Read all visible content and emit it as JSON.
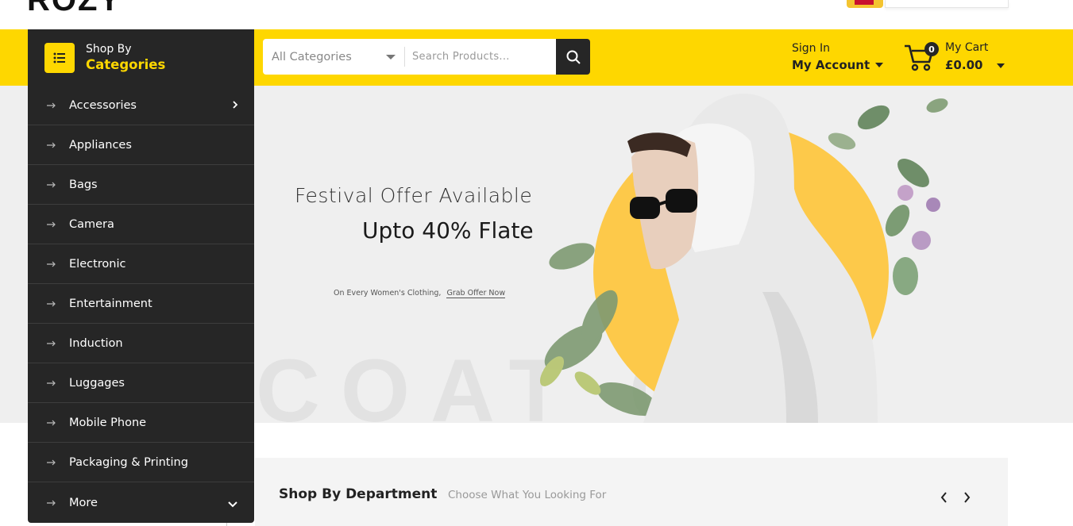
{
  "logo": {
    "text": "ROZY"
  },
  "categories": {
    "heading_line1": "Shop By",
    "heading_line2": "Categories",
    "items": [
      {
        "label": "Accessories",
        "has_submenu": true
      },
      {
        "label": "Appliances"
      },
      {
        "label": "Bags"
      },
      {
        "label": "Camera"
      },
      {
        "label": "Electronic"
      },
      {
        "label": "Entertainment"
      },
      {
        "label": "Induction"
      },
      {
        "label": "Luggages"
      },
      {
        "label": "Mobile Phone"
      },
      {
        "label": "Packaging & Printing"
      }
    ],
    "more_label": "More"
  },
  "search": {
    "category_selected": "All Categories",
    "placeholder": "Search Products..."
  },
  "account": {
    "sign_in": "Sign In",
    "my_account": "My Account"
  },
  "cart": {
    "count": "0",
    "label": "My Cart",
    "amount": "£0.00"
  },
  "hero": {
    "headline1": "Festival Offer Available",
    "headline2": "Upto 40% Flate",
    "subtext": "On Every Women's Clothing,",
    "cta": "Grab Offer Now",
    "watermark": "COAT   OY"
  },
  "department": {
    "title": "Shop By Department",
    "subtitle": "Choose What You Looking For"
  },
  "colors": {
    "accent": "#fed700",
    "dark": "#262626",
    "hero_bg": "#efefef",
    "circle": "#fdc94a"
  }
}
